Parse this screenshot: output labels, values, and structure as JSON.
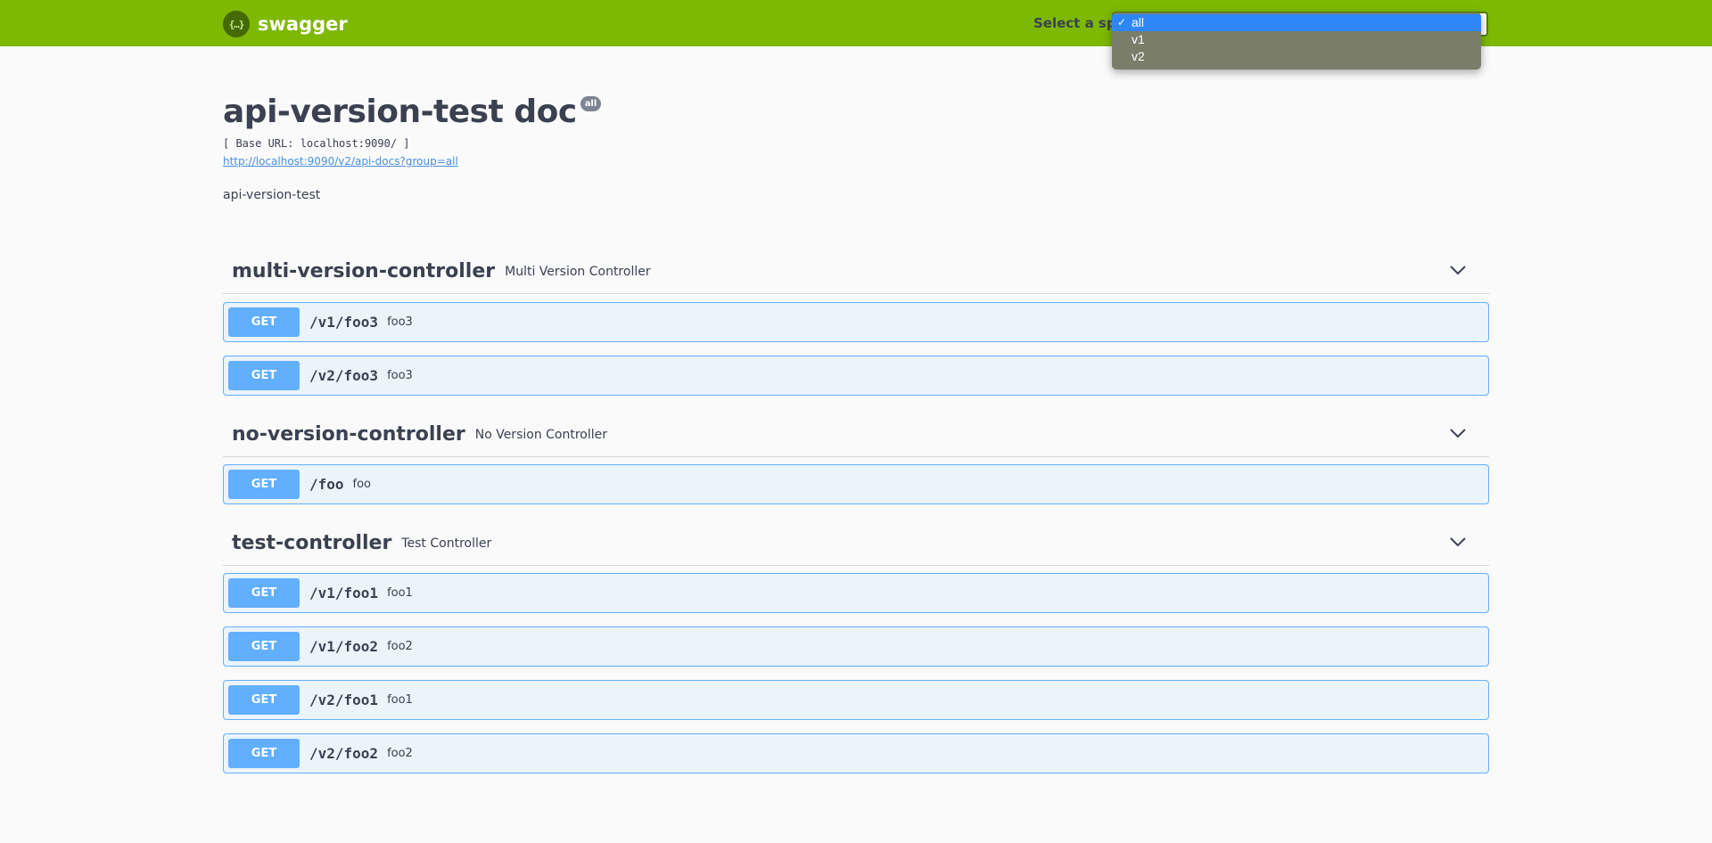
{
  "topbar": {
    "logo_symbol": "{…}",
    "logo_text": "swagger",
    "spec_label": "Select a spec",
    "spec_options": [
      {
        "label": "all",
        "selected": true
      },
      {
        "label": "v1",
        "selected": false
      },
      {
        "label": "v2",
        "selected": false
      }
    ],
    "check_mark": "✓"
  },
  "info": {
    "title": "api-version-test doc",
    "version_badge": "all",
    "base_url": "[ Base URL: localhost:9090/ ]",
    "spec_link": "http://localhost:9090/v2/api-docs?group=all",
    "description": "api-version-test"
  },
  "tags": [
    {
      "name": "multi-version-controller",
      "description": "Multi Version Controller",
      "operations": [
        {
          "method": "GET",
          "path": "/v1/foo3",
          "summary": "foo3"
        },
        {
          "method": "GET",
          "path": "/v2/foo3",
          "summary": "foo3"
        }
      ]
    },
    {
      "name": "no-version-controller",
      "description": "No Version Controller",
      "operations": [
        {
          "method": "GET",
          "path": "/foo",
          "summary": "foo"
        }
      ]
    },
    {
      "name": "test-controller",
      "description": "Test Controller",
      "operations": [
        {
          "method": "GET",
          "path": "/v1/foo1",
          "summary": "foo1"
        },
        {
          "method": "GET",
          "path": "/v1/foo2",
          "summary": "foo2"
        },
        {
          "method": "GET",
          "path": "/v2/foo1",
          "summary": "foo1"
        },
        {
          "method": "GET",
          "path": "/v2/foo2",
          "summary": "foo2"
        }
      ]
    }
  ],
  "colors": {
    "topbar": "#7eb800",
    "get_method": "#61affe",
    "get_background": "#ebf3fb",
    "dropdown_highlight": "#2e86f6"
  },
  "icons": {
    "logo": "swagger-logo-icon",
    "tag_toggle": "chevron-down-icon",
    "selected_option": "checkmark-icon"
  }
}
